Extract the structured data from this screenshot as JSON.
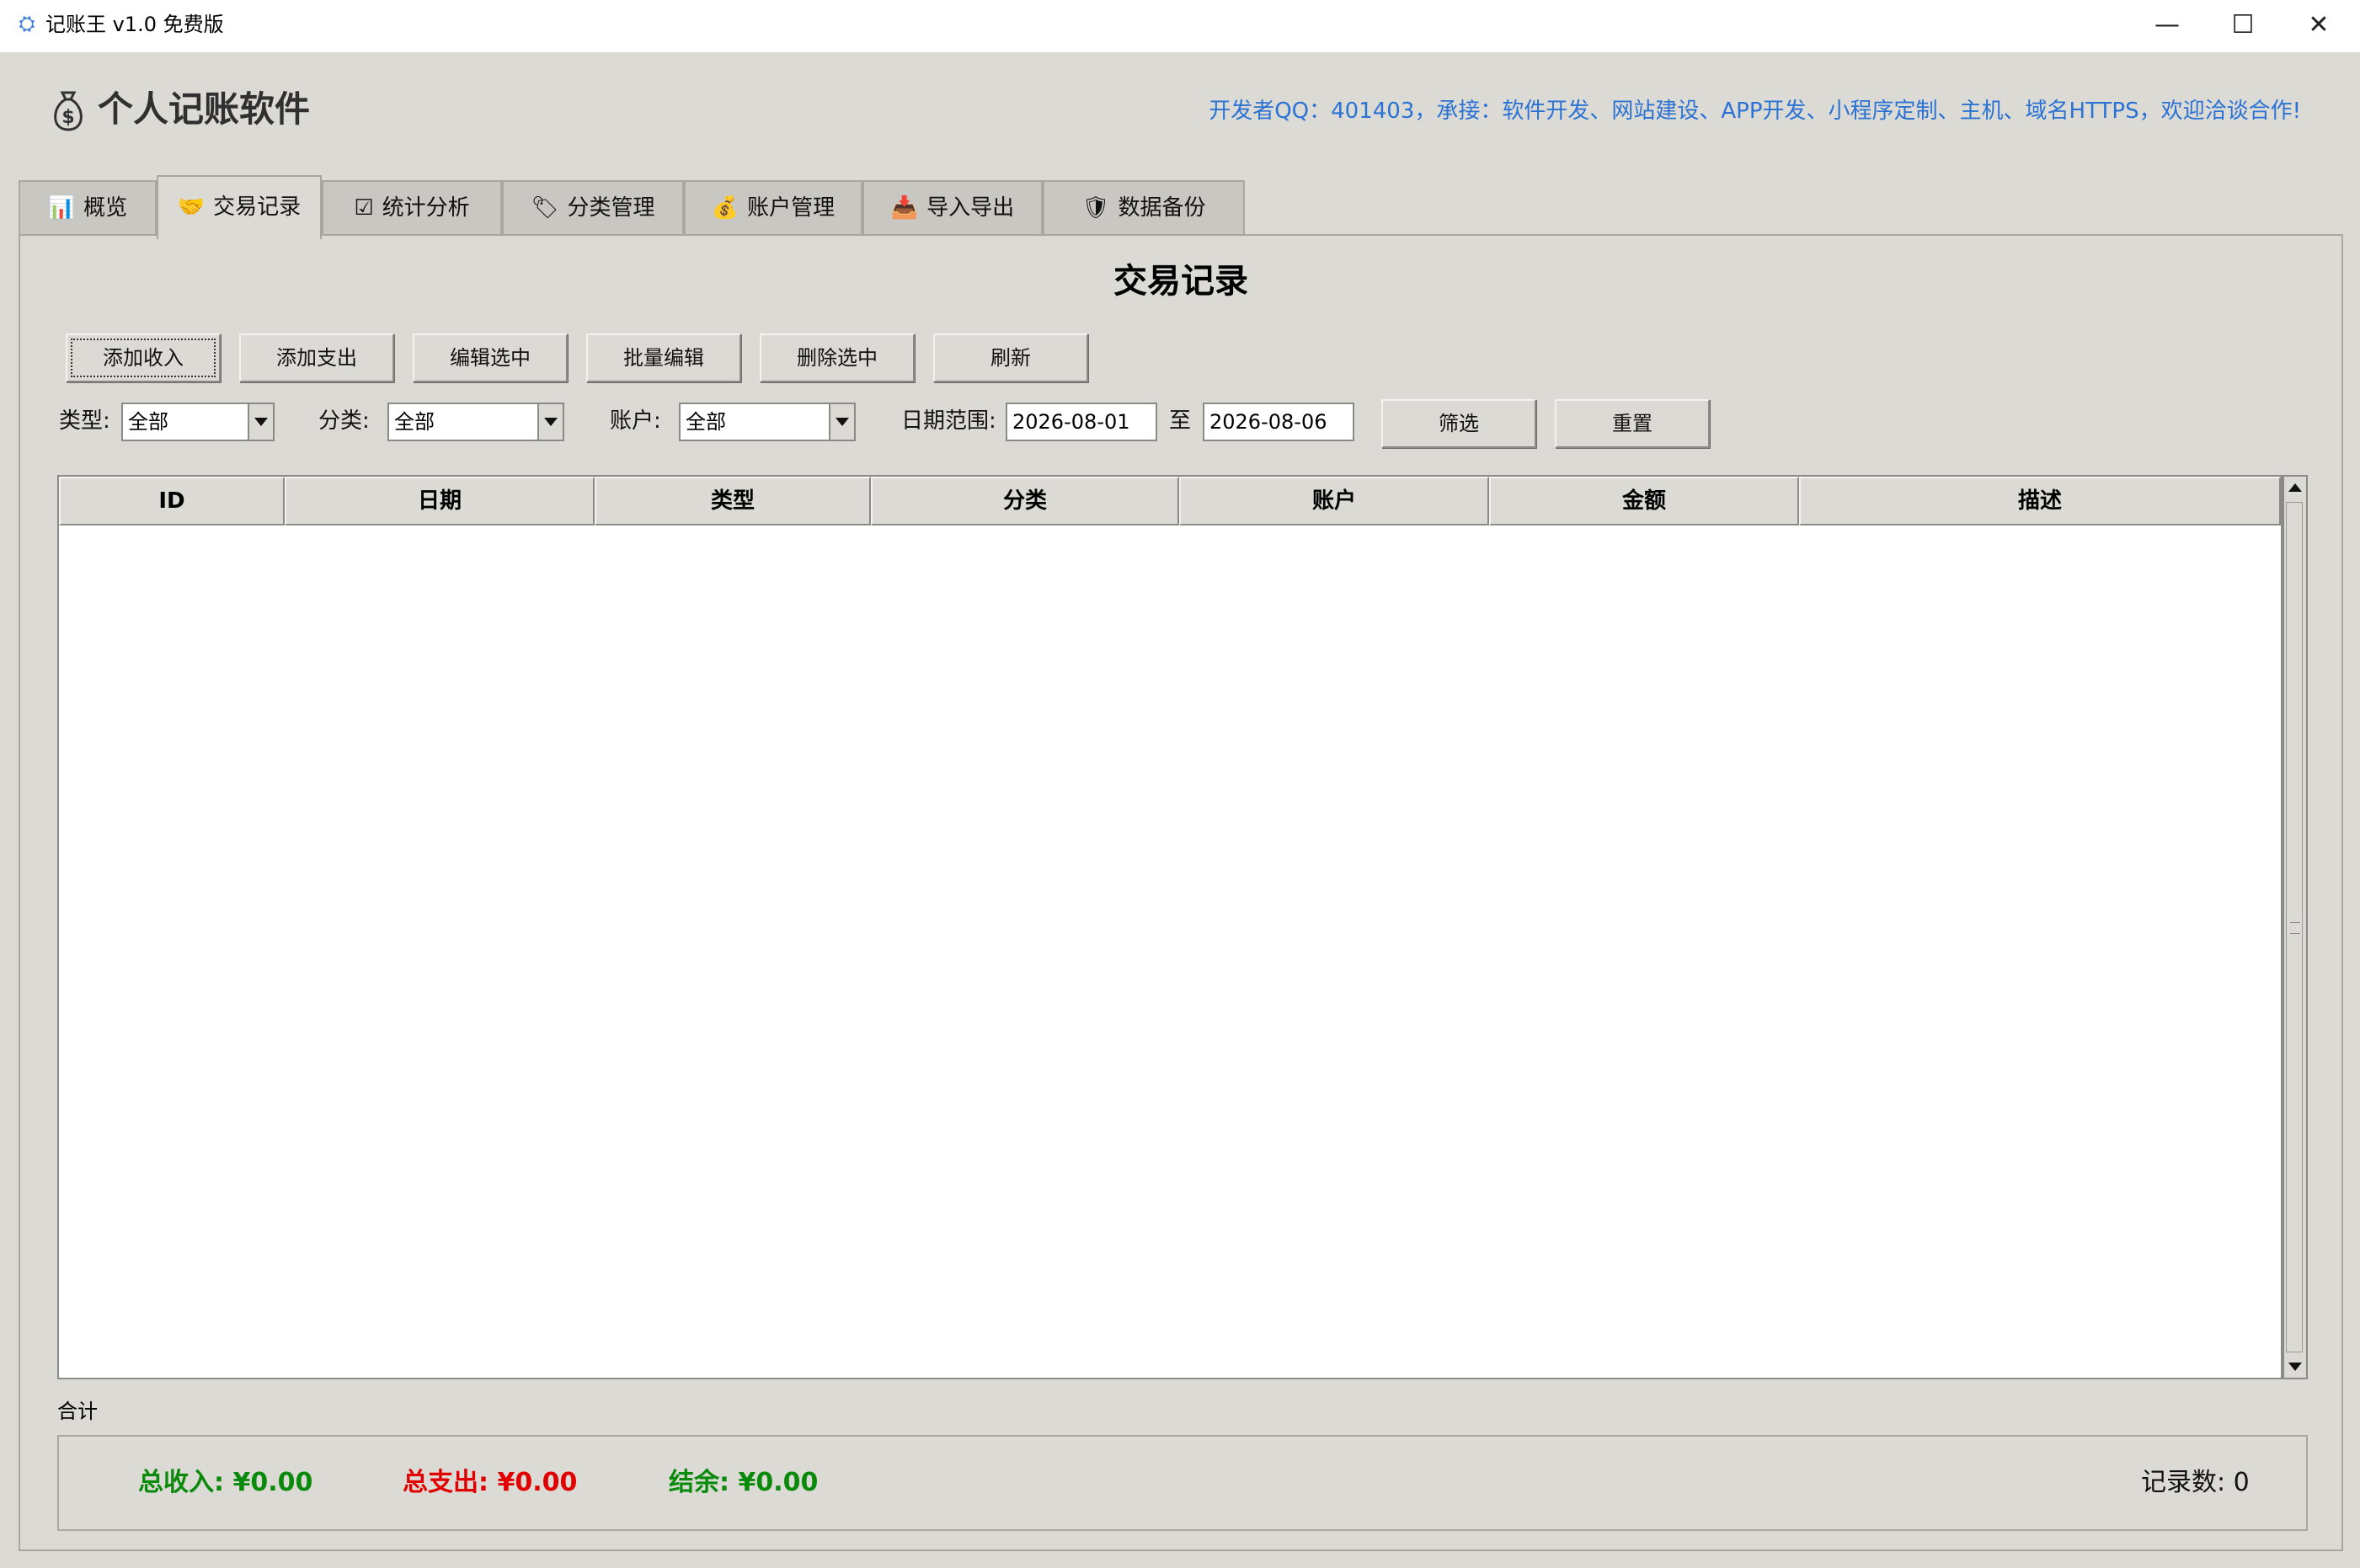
{
  "window": {
    "title": "记账王 v1.0 免费版",
    "controls": {
      "minimize": "—",
      "maximize": "☐",
      "close": "✕"
    }
  },
  "header": {
    "app_name": "个人记账软件",
    "developer_info": "开发者QQ：401403，承接：软件开发、网站建设、APP开发、小程序定制、主机、域名HTTPS，欢迎洽谈合作!"
  },
  "tabs": [
    {
      "label": "概览",
      "icon": "bar-chart-icon",
      "glyph": "📊"
    },
    {
      "label": "交易记录",
      "icon": "handshake-icon",
      "glyph": "🤝"
    },
    {
      "label": "统计分析",
      "icon": "checkbox-icon",
      "glyph": "☑"
    },
    {
      "label": "分类管理",
      "icon": "tag-icon",
      "glyph": "🏷"
    },
    {
      "label": "账户管理",
      "icon": "money-bag-icon",
      "glyph": "💰"
    },
    {
      "label": "导入导出",
      "icon": "inbox-tray-icon",
      "glyph": "📥"
    },
    {
      "label": "数据备份",
      "icon": "shield-icon",
      "glyph": "🛡"
    }
  ],
  "active_tab": "交易记录",
  "transactions": {
    "title": "交易记录",
    "buttons": {
      "add_income": "添加收入",
      "add_expense": "添加支出",
      "edit_selected": "编辑选中",
      "batch_edit": "批量编辑",
      "delete_selected": "删除选中",
      "refresh": "刷新"
    },
    "filters": {
      "type_label": "类型:",
      "type_value": "全部",
      "category_label": "分类:",
      "category_value": "全部",
      "account_label": "账户:",
      "account_value": "全部",
      "date_label": "日期范围:",
      "date_from": "2026-08-01",
      "date_sep": "至",
      "date_to": "2026-08-06",
      "filter_button": "筛选",
      "reset_button": "重置"
    },
    "columns": [
      "ID",
      "日期",
      "类型",
      "分类",
      "账户",
      "金额",
      "描述"
    ],
    "rows": []
  },
  "summary": {
    "label": "合计",
    "total_income": "总收入: ¥0.00",
    "total_expense": "总支出: ¥0.00",
    "balance": "结余: ¥0.00",
    "record_count": "记录数: 0"
  },
  "colors": {
    "background": "#dcdad5",
    "income": "#0a8a0a",
    "expense": "#e00000",
    "link": "#2a73d4"
  }
}
